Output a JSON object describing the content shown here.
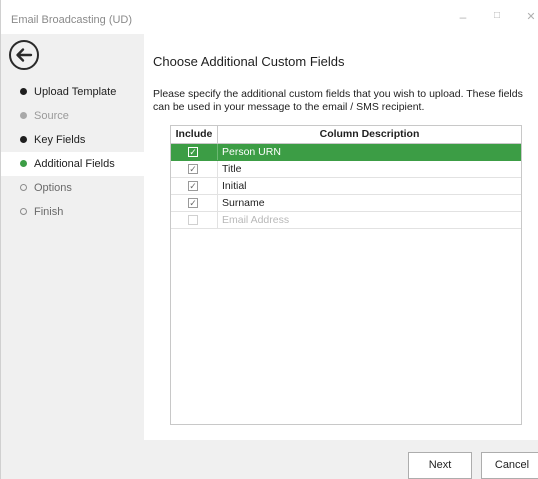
{
  "window": {
    "title": "Email Broadcasting (UD)",
    "minimize": "–",
    "maximize": "□",
    "close": "✕"
  },
  "sidebar": {
    "items": [
      {
        "label": "Upload Template",
        "state": "done"
      },
      {
        "label": "Source",
        "state": "disabled"
      },
      {
        "label": "Key Fields",
        "state": "done"
      },
      {
        "label": "Additional Fields",
        "state": "current"
      },
      {
        "label": "Options",
        "state": "todo"
      },
      {
        "label": "Finish",
        "state": "todo"
      }
    ]
  },
  "main": {
    "heading": "Choose Additional Custom Fields",
    "description": "Please specify the additional custom fields that you wish to upload.  These fields can be used in your message to the email / SMS recipient.",
    "grid": {
      "columns": [
        "Include",
        "Column Description"
      ],
      "rows": [
        {
          "description": "Person URN",
          "checked": true,
          "enabled": true,
          "selected": true
        },
        {
          "description": "Title",
          "checked": true,
          "enabled": true,
          "selected": false
        },
        {
          "description": "Initial",
          "checked": true,
          "enabled": true,
          "selected": false
        },
        {
          "description": "Surname",
          "checked": true,
          "enabled": true,
          "selected": false
        },
        {
          "description": "Email Address",
          "checked": false,
          "enabled": false,
          "selected": false
        }
      ]
    }
  },
  "footer": {
    "next_label": "Next",
    "cancel_label": "Cancel"
  },
  "colors": {
    "accent": "#3c9d45"
  }
}
